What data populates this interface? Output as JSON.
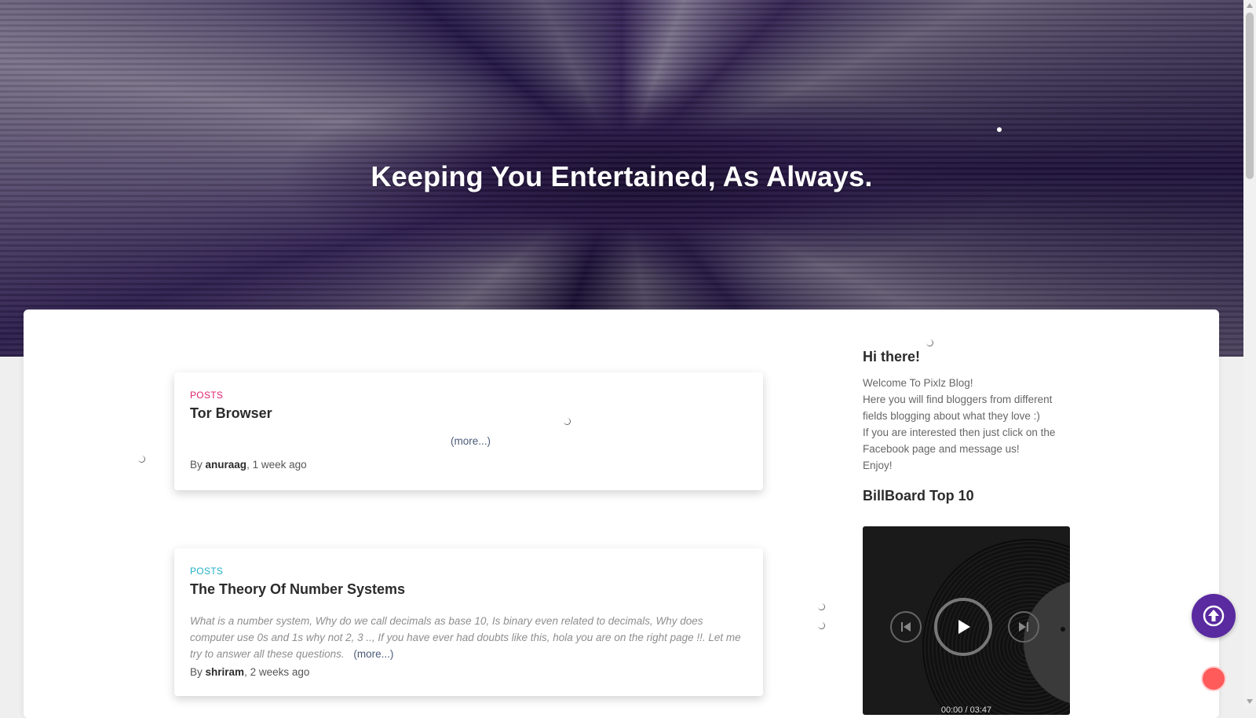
{
  "hero": {
    "title": "Keeping You Entertained, As Always."
  },
  "posts": [
    {
      "category": "POSTS",
      "title": "Tor Browser",
      "excerpt": "",
      "more": "(more...)",
      "by": "By",
      "author": "anuraag",
      "age": ", 1 week ago"
    },
    {
      "category": "POSTS",
      "title": "The Theory Of Number Systems",
      "excerpt": "What is a number system, Why do we call decimals as base 10,  Is binary even related to decimals, Why does computer use 0s and 1s why not 2, 3 .., If you have ever had doubts like this, hola you are on the right page !!. Let me try to answer all these questions.",
      "more": "(more...)",
      "by": "By",
      "author": "shriram",
      "age": ", 2 weeks ago"
    }
  ],
  "sidebar": {
    "greeting_title": "Hi there!",
    "greeting_lines": [
      "Welcome To Pixlz Blog!",
      "Here you will find bloggers from different fields blogging about what they love :)",
      "If you are interested then just click on the Facebook page and message us!",
      "Enjoy!"
    ],
    "chart_title": "BillBoard Top 10"
  },
  "player": {
    "time": "00:00 / 03:47"
  },
  "icons": {
    "prev": "skip-previous-icon",
    "play": "play-icon",
    "next": "skip-next-icon",
    "scroll_top": "arrow-up-circle-icon",
    "notifications": "bell-icon"
  },
  "colors": {
    "category_red": "#e0226e",
    "category_cyan": "#22b0c8",
    "accent_purple": "#5a2aa0"
  }
}
